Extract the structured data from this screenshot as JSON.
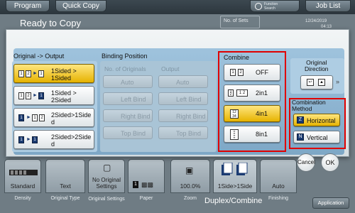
{
  "topbar": {
    "program": "Program",
    "quick_copy": "Quick Copy",
    "search_line1": "Function",
    "search_line2": "Search",
    "job_list": "Job List"
  },
  "background": {
    "title": "Ready to Copy",
    "sets_label": "No. of Sets",
    "date": "12/24/2019",
    "time": "04:13"
  },
  "bottom_tabs": [
    {
      "value": "Standard",
      "label": "Density"
    },
    {
      "value": "Text",
      "label": "Original Type"
    },
    {
      "value": "No Original Settings",
      "label": "Original Settings"
    },
    {
      "value": "1",
      "label": "Paper"
    },
    {
      "value": "100.0%",
      "label": "Zoom"
    },
    {
      "value": "1Side>1Side",
      "label": "Duplex/Combine"
    },
    {
      "value": "Auto",
      "label": "Finishing"
    }
  ],
  "application_button": "Application",
  "dialog": {
    "original_output": {
      "title": "Original -> Output",
      "options": [
        {
          "label1": "1Sided >",
          "label2": "1Sided",
          "selected": true
        },
        {
          "label1": "1Sided >",
          "label2": "2Sided",
          "selected": false
        },
        {
          "label1": "2Sided>1Side",
          "label2": "d",
          "selected": false
        },
        {
          "label1": "2Sided>2Side",
          "label2": "d",
          "selected": false
        }
      ]
    },
    "binding_position": {
      "title": "Binding Position",
      "originals_title": "No. of Originals",
      "output_title": "Output",
      "originals_options": [
        "Auto",
        "Left Bind",
        "Right Bind",
        "Top Bind"
      ],
      "output_options": [
        "Auto",
        "Left Bind",
        "Right Bind",
        "Top Bind"
      ]
    },
    "combine": {
      "title": "Combine",
      "options": [
        {
          "label": "OFF",
          "selected": false
        },
        {
          "label": "2in1",
          "selected": false
        },
        {
          "label": "4in1",
          "selected": true
        },
        {
          "label": "8in1",
          "selected": false
        }
      ]
    },
    "original_direction": {
      "title_line1": "Original",
      "title_line2": "Direction"
    },
    "combination_method": {
      "title_line1": "Combination",
      "title_line2": "Method",
      "options": [
        {
          "label": "Horizontal",
          "selected": true
        },
        {
          "label": "Vertical",
          "selected": false
        }
      ]
    },
    "cancel": "Cancel",
    "ok": "OK"
  },
  "colors": {
    "selected": "#e6b300",
    "highlight_outline": "#e00000",
    "panel_blue": "#7ea7c6"
  }
}
